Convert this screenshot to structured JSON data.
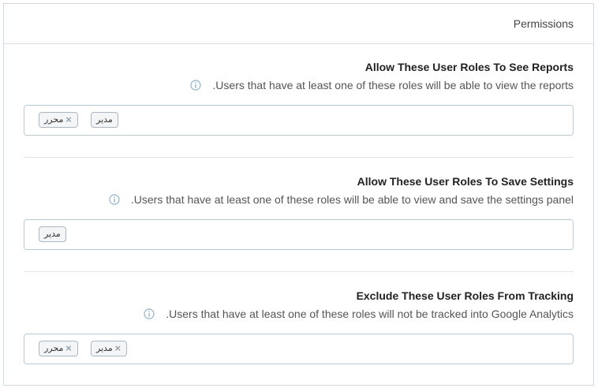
{
  "panel": {
    "title": "Permissions"
  },
  "sections": [
    {
      "title": "Allow These User Roles To See Reports",
      "description": ".Users that have at least one of these roles will be able to view the reports",
      "tags": [
        {
          "label": "محرر",
          "removable": true
        },
        {
          "label": "مدير",
          "removable": false
        }
      ]
    },
    {
      "title": "Allow These User Roles To Save Settings",
      "description": ".Users that have at least one of these roles will be able to view and save the settings panel",
      "tags": [
        {
          "label": "مدير",
          "removable": false
        }
      ]
    },
    {
      "title": "Exclude These User Roles From Tracking",
      "description": ".Users that have at least one of these roles will not be tracked into Google Analytics",
      "tags": [
        {
          "label": "محرر",
          "removable": true
        },
        {
          "label": "مدير",
          "removable": true
        }
      ]
    }
  ],
  "icons": {
    "info": "info-circle-icon",
    "remove": "×"
  },
  "colors": {
    "border": "#cdd8e0",
    "info": "#8fb3c9",
    "tag_bg": "#f3f5f7"
  }
}
